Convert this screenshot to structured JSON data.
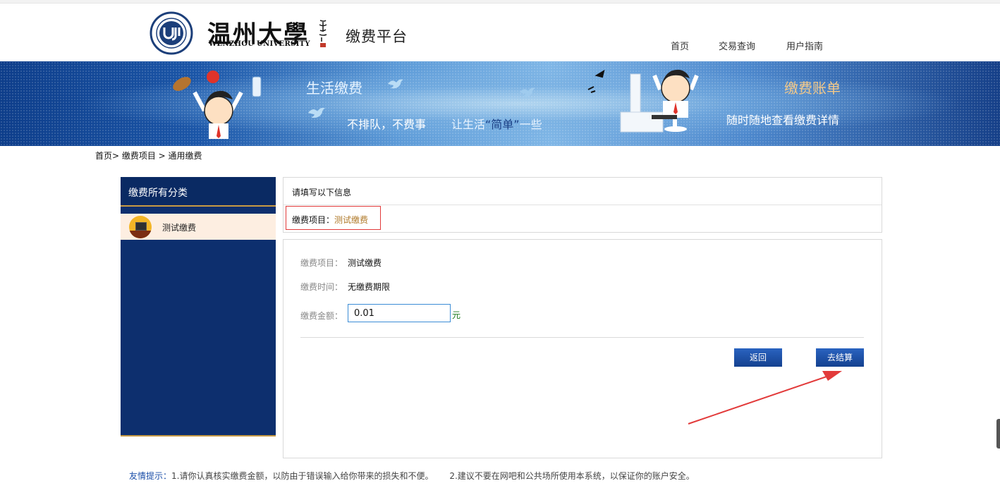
{
  "header": {
    "logo_cn": "温州大學",
    "logo_en": "WENZHOU UNIVERSITY",
    "platform": "缴费平台",
    "nav": [
      "首页",
      "交易查询",
      "用户指南"
    ]
  },
  "banner": {
    "left_title": "生活缴费",
    "slogan_a": "不排队，不费事",
    "slogan_b_prefix": "让生活",
    "slogan_b_highlight": "“简单”",
    "slogan_b_suffix": "一些",
    "right_title": "缴费账单",
    "right_sub": "随时随地查看缴费详情"
  },
  "breadcrumb": "首页> 缴费项目 > 通用缴费",
  "sidebar": {
    "title": "缴费所有分类",
    "items": [
      {
        "label": "测试缴费",
        "icon": "computer-desk-icon"
      }
    ]
  },
  "info": {
    "title": "请填写以下信息",
    "project_label": "缴费项目：",
    "project_value": "测试缴费"
  },
  "form": {
    "project_label": "缴费项目：",
    "project_value": "测试缴费",
    "time_label": "缴费时间：",
    "time_value": "无缴费期限",
    "amount_label": "缴费金额：",
    "amount_value": "0.01",
    "unit": "元",
    "back_label": "返回",
    "checkout_label": "去结算"
  },
  "tips": {
    "label": "友情提示：",
    "tip1": "1.请你认真核实缴费金额，以防由于错误输入给你带来的损失和不便。",
    "tip2": "2.建议不要在网吧和公共场所使用本系统，以保证你的账户安全。"
  },
  "colors": {
    "navy": "#0d2f6e",
    "button": "#1a4ea8",
    "gold_line": "#c89a43",
    "annotation_red": "#e23a3a"
  }
}
